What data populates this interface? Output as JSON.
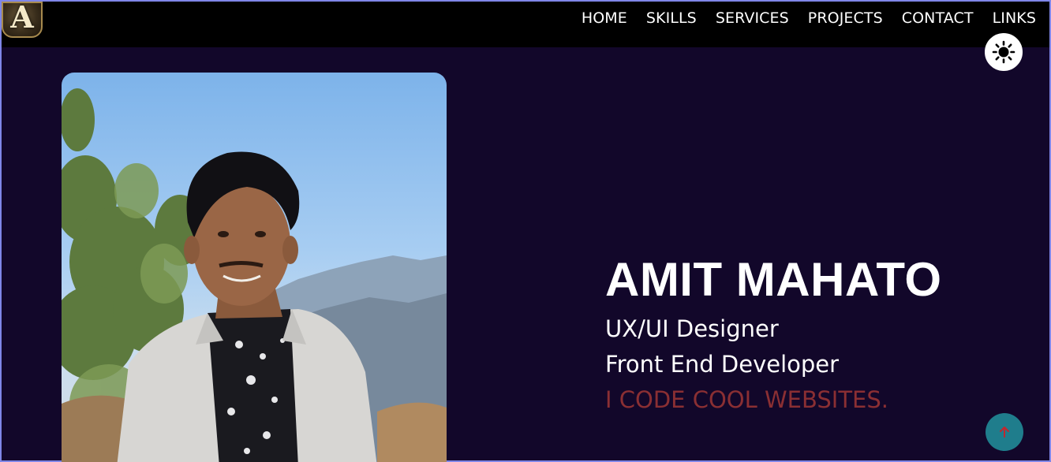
{
  "logo": {
    "letter": "A"
  },
  "nav": {
    "items": [
      {
        "label": "HOME"
      },
      {
        "label": "SKILLS"
      },
      {
        "label": "SERVICES"
      },
      {
        "label": "PROJECTS"
      },
      {
        "label": "CONTACT"
      },
      {
        "label": "LINKS"
      }
    ],
    "theme_toggle_icon": "sun-icon"
  },
  "hero": {
    "name": "AMIT MAHATO",
    "roles": [
      "UX/UI Designer",
      "Front End Developer"
    ],
    "tagline": "I CODE COOL WEBSITES.",
    "portrait_icon": "profile-photo"
  },
  "scroll_top": {
    "icon": "arrow-up-icon"
  },
  "colors": {
    "background": "#12072a",
    "navbar": "#000000",
    "tagline": "#8a2f33",
    "scroll_button": "#1f7d8c",
    "border": "#7f86e8"
  }
}
